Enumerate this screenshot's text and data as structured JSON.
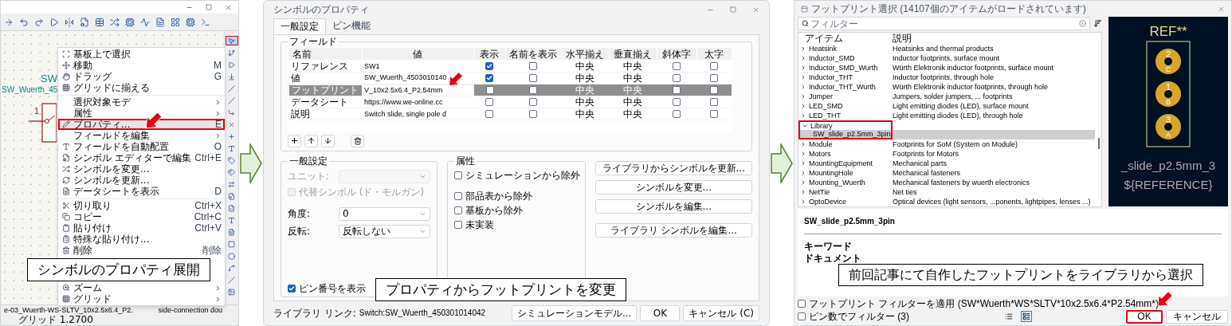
{
  "schematic_editor": {
    "symbol": {
      "reference": "SW",
      "value": "SW_Wuerth_45",
      "pin_number": "1"
    },
    "tools": [
      {
        "selected": true,
        "annotated": true
      },
      {
        "selected": false,
        "annotated": false
      },
      {
        "selected": false,
        "annotated": false
      },
      {
        "selected": false,
        "annotated": false
      },
      {
        "selected": false,
        "annotated": false
      },
      {
        "selected": false,
        "annotated": false
      },
      {
        "selected": false,
        "annotated": false
      },
      {
        "selected": false,
        "annotated": false
      },
      {
        "selected": false,
        "annotated": false
      },
      {
        "selected": false,
        "annotated": false
      },
      {
        "selected": false,
        "annotated": false
      },
      {
        "selected": false,
        "annotated": false
      },
      {
        "selected": false,
        "annotated": false
      },
      {
        "selected": false,
        "annotated": false
      },
      {
        "selected": false,
        "annotated": false
      },
      {
        "selected": false,
        "annotated": false
      },
      {
        "selected": false,
        "annotated": false
      },
      {
        "selected": false,
        "annotated": false
      },
      {
        "selected": false,
        "annotated": false
      },
      {
        "selected": false,
        "annotated": false
      },
      {
        "selected": false,
        "annotated": false
      },
      {
        "selected": false,
        "annotated": false
      }
    ],
    "context_menu": {
      "items": [
        {
          "kind": "item",
          "label": "基板上で選択",
          "submenu": false,
          "selected": false,
          "annotated": false
        },
        {
          "kind": "item",
          "label": "移動",
          "shortcut": "M",
          "submenu": false,
          "selected": false,
          "annotated": false
        },
        {
          "kind": "item",
          "label": "ドラッグ",
          "shortcut": "G",
          "submenu": false,
          "selected": false,
          "annotated": false
        },
        {
          "kind": "item",
          "label": "グリッドに揃える",
          "submenu": false,
          "selected": false,
          "annotated": false
        },
        {
          "kind": "separator"
        },
        {
          "kind": "item",
          "label": "選択対象モデ",
          "submenu": true,
          "selected": false,
          "annotated": false
        },
        {
          "kind": "item",
          "label": "属性",
          "submenu": true,
          "selected": false,
          "annotated": false
        },
        {
          "kind": "item",
          "label": "プロパティ...",
          "shortcut": "E",
          "submenu": false,
          "selected": true,
          "annotated": true
        },
        {
          "kind": "item",
          "label": "フィールドを編集",
          "submenu": true,
          "selected": false,
          "annotated": false
        },
        {
          "kind": "item",
          "label": "フィールドを自動配置",
          "shortcut": "O",
          "submenu": false,
          "selected": false,
          "annotated": false
        },
        {
          "kind": "item",
          "label": "シンボル エディターで編集",
          "shortcut": "Ctrl+E",
          "submenu": false,
          "selected": false,
          "annotated": false
        },
        {
          "kind": "item",
          "label": "シンボルを変更...",
          "submenu": false,
          "selected": false,
          "annotated": false
        },
        {
          "kind": "item",
          "label": "シンボルを更新...",
          "submenu": false,
          "selected": false,
          "annotated": false
        },
        {
          "kind": "item",
          "label": "データシートを表示",
          "shortcut": "D",
          "submenu": false,
          "selected": false,
          "annotated": false
        },
        {
          "kind": "separator"
        },
        {
          "kind": "item",
          "label": "切り取り",
          "shortcut": "Ctrl+X",
          "submenu": false,
          "selected": false,
          "annotated": false
        },
        {
          "kind": "item",
          "label": "コピー",
          "shortcut": "Ctrl+C",
          "submenu": false,
          "selected": false,
          "annotated": false
        },
        {
          "kind": "item",
          "label": "貼り付け",
          "shortcut": "Ctrl+V",
          "submenu": false,
          "selected": false,
          "annotated": false
        },
        {
          "kind": "item",
          "label": "特殊な貼り付け...",
          "submenu": false,
          "selected": false,
          "annotated": false
        },
        {
          "kind": "item",
          "label": "削除",
          "shortcut": "削除",
          "submenu": false,
          "selected": false,
          "annotated": false
        }
      ],
      "lower_items": [
        {
          "kind": "item",
          "label": "ズーム",
          "submenu": true,
          "selected": false,
          "annotated": false
        },
        {
          "kind": "item",
          "label": "グリッド",
          "submenu": true,
          "selected": false,
          "annotated": false
        }
      ]
    },
    "status_bar": {
      "file": "e-03_Wuerth-WS-SLTV_10x2.5x6.4_P2.",
      "right": "side-connection dou",
      "grid": "グリッド 1.2700"
    },
    "caption": "シンボルのプロパティ展開"
  },
  "properties_dialog": {
    "title": "シンボルのプロパティ",
    "tabs": [
      {
        "label": "一般設定",
        "selected": true
      },
      {
        "label": "ピン機能",
        "selected": false
      }
    ],
    "fields_group": "フィールド",
    "columns": [
      "名前",
      "値",
      "表示",
      "名前を表示",
      "水平揃え",
      "垂直揃え",
      "斜体字",
      "太字"
    ],
    "fields": [
      {
        "name": "リファレンス",
        "value": "SW1",
        "show": true,
        "show_name": false,
        "h_align": "中央",
        "v_align": "中央",
        "italic": false,
        "bold": false,
        "selected": false,
        "annotated": false
      },
      {
        "name": "値",
        "value": "SW_Wuerth_4503010140",
        "show": true,
        "show_name": false,
        "h_align": "中央",
        "v_align": "中央",
        "italic": false,
        "bold": false,
        "selected": false,
        "annotated": false
      },
      {
        "name": "フットプリント",
        "value": "V_10x2.5x6.4_P2.54mm",
        "show": false,
        "show_name": false,
        "h_align": "中央",
        "v_align": "中央",
        "italic": false,
        "bold": false,
        "selected": true,
        "annotated": true
      },
      {
        "name": "データシート",
        "value": "https://www.we-online.cc",
        "show": false,
        "show_name": false,
        "h_align": "中央",
        "v_align": "中央",
        "italic": false,
        "bold": false,
        "selected": false,
        "annotated": false
      },
      {
        "name": "説明",
        "value": "Switch slide, single pole d",
        "show": false,
        "show_name": false,
        "h_align": "中央",
        "v_align": "中央",
        "italic": false,
        "bold": false,
        "selected": false,
        "annotated": false
      }
    ],
    "general": {
      "title": "一般設定",
      "unit_label": "ユニット:",
      "alternate": {
        "label": "代替シンボル (ド・モルガン)",
        "checked": false,
        "disabled": true
      },
      "angle_label": "角度:",
      "angle_value": "0",
      "mirror_label": "反転:",
      "mirror_value": "反転しない",
      "pin_numbers": {
        "label": "ピン番号を表示",
        "checked": true
      }
    },
    "attributes": {
      "title": "属性",
      "options": [
        {
          "label": "シミュレーションから除外",
          "checked": false
        },
        {
          "label": "部品表から除外",
          "checked": false
        },
        {
          "label": "基板から除外",
          "checked": false
        },
        {
          "label": "未実装",
          "checked": false
        }
      ]
    },
    "side_buttons": [
      "ライブラリからシンボルを更新...",
      "シンボルを変更...",
      "シンボルを編集...",
      "ライブラリ シンボルを編集..."
    ],
    "library_link_label": "ライブラリ リンク:",
    "library_link": "Switch:SW_Wuerth_450301014042",
    "footer_buttons": [
      "シミュレーションモデル...",
      "OK",
      "キャンセル (C)"
    ],
    "caption": "プロパティからフットプリントを変更"
  },
  "footprint_chooser": {
    "title": "フットプリント選択 (14107個のアイテムがロードされています)",
    "filter_placeholder": "フィルター",
    "columns": [
      "アイテム",
      "説明"
    ],
    "libraries": [
      {
        "name": "Heatsink",
        "description": "Heatsinks and thermal products",
        "expanded": false,
        "annotated": false
      },
      {
        "name": "Inductor_SMD",
        "description": "Inductor footprints, surface mount",
        "expanded": false,
        "annotated": false
      },
      {
        "name": "Inductor_SMD_Wurth",
        "description": "Würth Elektronik inductor footprints, surface mount",
        "expanded": false,
        "annotated": false
      },
      {
        "name": "Inductor_THT",
        "description": "Inductor footprints, through hole",
        "expanded": false,
        "annotated": false
      },
      {
        "name": "Inductor_THT_Wurth",
        "description": "Würth Elektronik inductor footprints, through hole",
        "expanded": false,
        "annotated": false
      },
      {
        "name": "Jumper",
        "description": "Jumpers, solder jumpers, ... footprints",
        "expanded": false,
        "annotated": false
      },
      {
        "name": "LED_SMD",
        "description": "Light emitting diodes (LED), surface mount",
        "expanded": false,
        "annotated": false
      },
      {
        "name": "LED_THT",
        "description": "Light emitting diodes (LED), through hole",
        "expanded": false,
        "annotated": false
      },
      {
        "name": "Library",
        "expanded": true,
        "annotated": true,
        "children": [
          {
            "name": "SW_slide_p2.5mm_3pin",
            "selected": true
          }
        ]
      },
      {
        "name": "Module",
        "description": "Footprints for SoM (System on Module)",
        "expanded": false,
        "annotated": false
      },
      {
        "name": "Motors",
        "description": "Footprints for Motors",
        "expanded": false,
        "annotated": false
      },
      {
        "name": "MountingEquipment",
        "description": "Mechanical parts",
        "expanded": false,
        "annotated": false
      },
      {
        "name": "MountingHole",
        "description": "Mechanical fasteners",
        "expanded": false,
        "annotated": false
      },
      {
        "name": "Mounting_Wuerth",
        "description": "Mechanical fasteners by wuerth electronics",
        "expanded": false,
        "annotated": false
      },
      {
        "name": "NetTie",
        "description": "Net ties",
        "expanded": false,
        "annotated": false
      },
      {
        "name": "OptoDevice",
        "description": "Optical devices (light sensors, ...ponents, lightpipes, lenses ...)",
        "expanded": false,
        "annotated": false
      }
    ],
    "preview": {
      "reference": "REF**",
      "value_text": "_slide_p2.5mm_3",
      "reference_field": "${REFERENCE}",
      "pads": [
        {
          "number": "2",
          "name": "C"
        },
        {
          "number": "1",
          "name": "B"
        },
        {
          "number": "3",
          "name": "A"
        }
      ]
    },
    "details": {
      "name": "SW_slide_p2.5mm_3pin",
      "keywords_label": "キーワード",
      "docs_label": "ドキュメント"
    },
    "filters": [
      {
        "label": "フットプリント フィルターを適用 (SW*Wuerth*WS*SLTV*10x2.5x6.4*P2.54mm*)",
        "checked": false
      },
      {
        "label": "ピン数でフィルター (3)",
        "checked": false
      }
    ],
    "view_modes": [
      {
        "selected": false
      },
      {
        "selected": true
      }
    ],
    "buttons": [
      {
        "label": "OK",
        "annotated": true
      },
      {
        "label": "キャンセル",
        "annotated": false
      }
    ],
    "caption": "前回記事にて自作したフットプリントをライブラリから選択"
  }
}
